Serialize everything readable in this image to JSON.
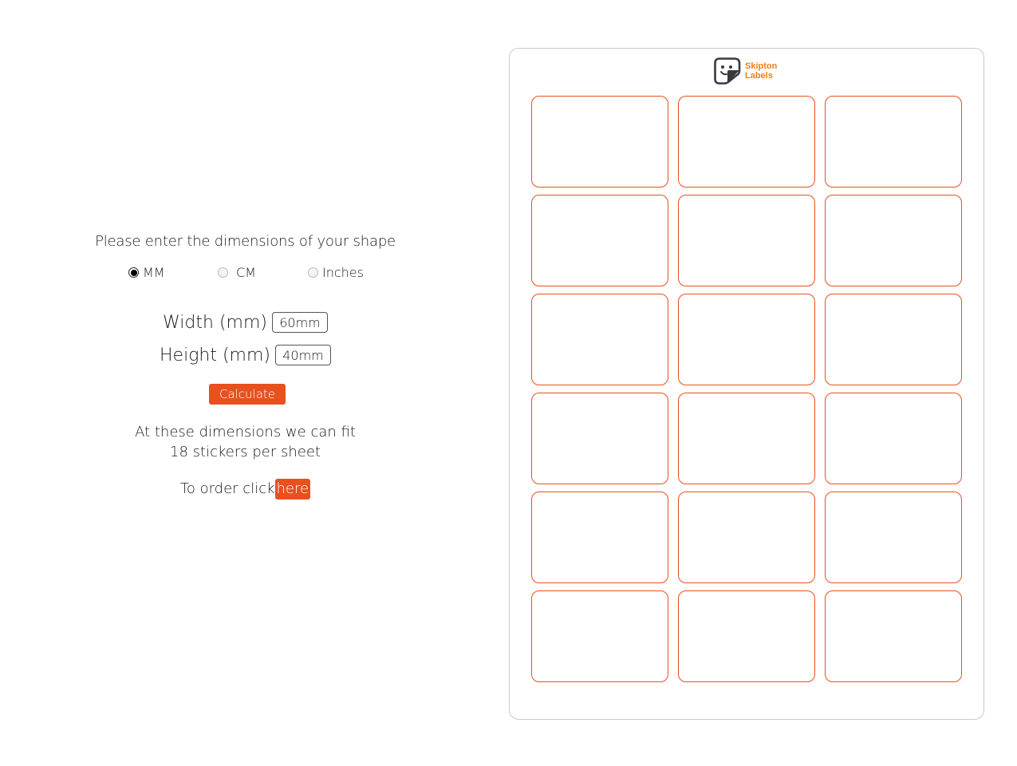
{
  "calculator": {
    "prompt": "Please enter the dimensions of your shape",
    "units": [
      {
        "label": "MM",
        "selected": true
      },
      {
        "label": "CM",
        "selected": false
      },
      {
        "label": "Inches",
        "selected": false
      }
    ],
    "width_label": "Width (mm)",
    "width_value": "60mm",
    "height_label": "Height (mm)",
    "height_value": "40mm",
    "calculate_label": "Calculate",
    "result_line1": "At these dimensions we can fit",
    "result_line2": "18 stickers per sheet",
    "order_prefix": "To order click",
    "order_link": "here"
  },
  "sheet": {
    "brand_line1": "Skipton",
    "brand_line2": "Labels",
    "label_count": 18,
    "columns": 3,
    "rows": 6
  },
  "colors": {
    "accent": "#e8501e",
    "brand": "#ef7d19",
    "sheet_border": "#c9c9c9"
  }
}
